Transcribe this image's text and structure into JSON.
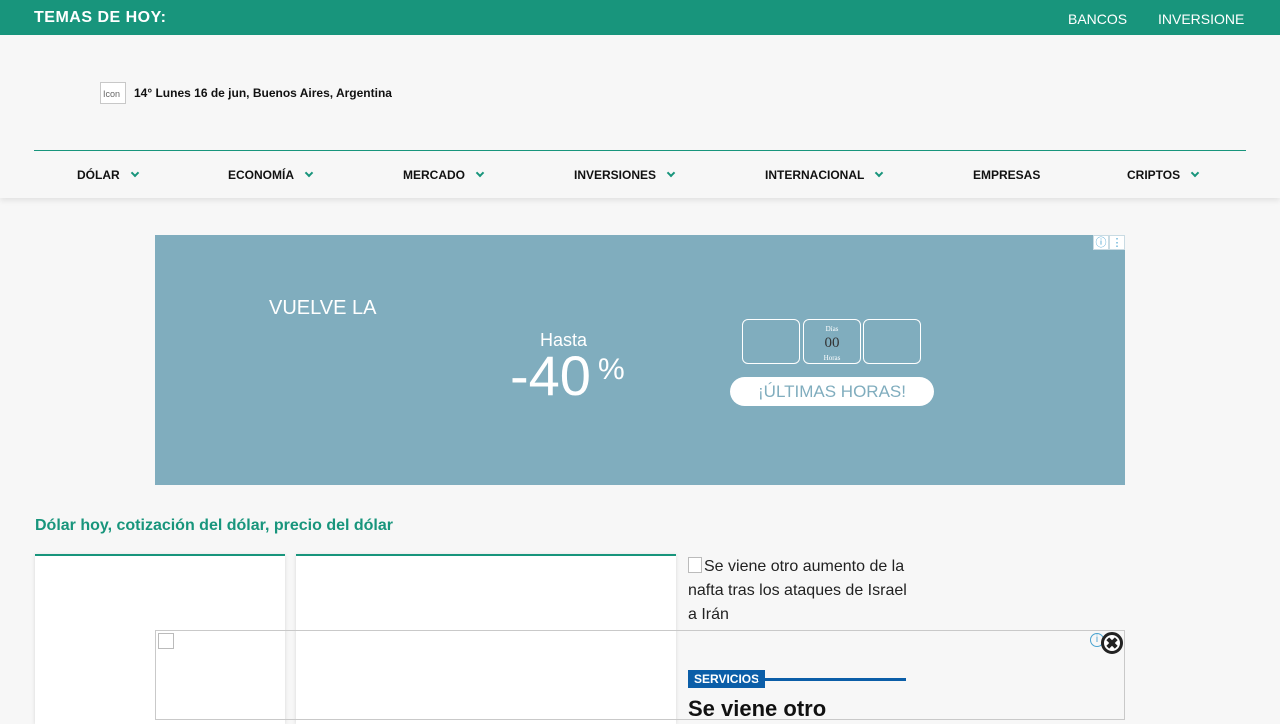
{
  "topbar": {
    "title": "TEMAS DE HOY:",
    "links": [
      "BANCOS",
      "INVERSIONE"
    ]
  },
  "header": {
    "weather_icon_alt": "Icon",
    "weather_text": "14° Lunes 16 de jun, Buenos Aires, Argentina"
  },
  "nav": {
    "items": [
      {
        "label": "DÓLAR",
        "dropdown": true
      },
      {
        "label": "ECONOMÍA",
        "dropdown": true
      },
      {
        "label": "MERCADO",
        "dropdown": true
      },
      {
        "label": "INVERSIONES",
        "dropdown": true
      },
      {
        "label": "INTERNACIONAL",
        "dropdown": true
      },
      {
        "label": "EMPRESAS",
        "dropdown": false
      },
      {
        "label": "CRIPTOS",
        "dropdown": true
      }
    ]
  },
  "ad": {
    "headline": "VUELVE LA",
    "hasta": "Hasta",
    "discount": "-40",
    "percent_sign": "%",
    "countdown_label_top": "Días",
    "countdown_value": "00",
    "countdown_label_bottom": "Horas",
    "cta": "¡ÚLTIMAS HORAS!",
    "info_icon": "info-icon",
    "menu_icon": "kebab-menu-icon"
  },
  "section": {
    "title": "Dólar hoy, cotización del dólar, precio del dólar"
  },
  "news": {
    "image_alt": "Se viene otro aumento de la nafta tras los ataques de Israel a Irán",
    "category": "SERVICIOS",
    "headline": "Se viene otro"
  },
  "colors": {
    "brand_green": "#18957c",
    "ad_bg": "#80adbe",
    "category_blue": "#0b5ea8"
  }
}
